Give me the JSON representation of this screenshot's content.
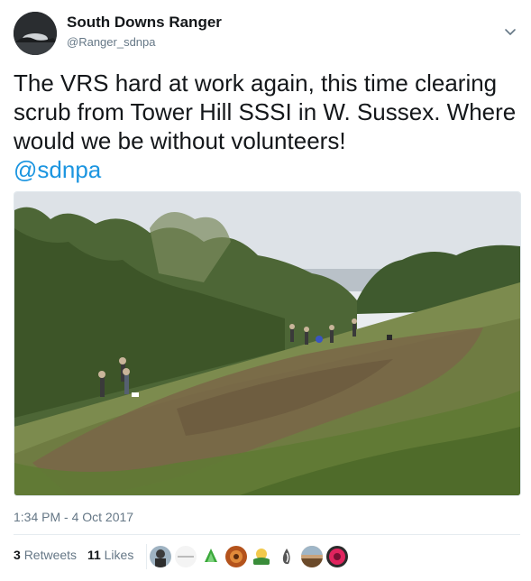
{
  "author": {
    "name": "South Downs Ranger",
    "handle": "@Ranger_sdnpa"
  },
  "tweet": {
    "text": "The VRS hard at work again, this time clearing scrub from Tower Hill SSSI in W. Sussex. Where would we be without volunteers!",
    "mention": "@sdnpa",
    "timestamp": "1:34 PM - 4 Oct 2017"
  },
  "stats": {
    "retweets_count": "3",
    "retweets_label": "Retweets",
    "likes_count": "11",
    "likes_label": "Likes"
  },
  "colors": {
    "link": "#1b95e0",
    "secondary_text": "#657786",
    "primary_text": "#14171a"
  },
  "icons": {
    "menu": "chevron-down-icon"
  }
}
